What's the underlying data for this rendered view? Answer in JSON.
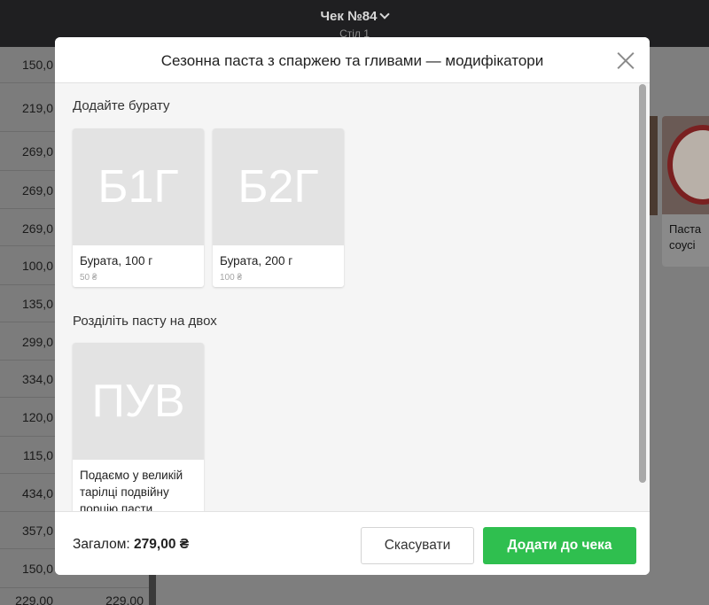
{
  "topbar": {
    "title": "Чек №84",
    "subtitle": "Стіл 1"
  },
  "background_rows": [
    {
      "price": "150,0",
      "total": ""
    },
    {
      "price": "219,0",
      "total": ""
    },
    {
      "price": "269,0",
      "total": ""
    },
    {
      "price": "269,0",
      "total": ""
    },
    {
      "price": "269,0",
      "total": ""
    },
    {
      "price": "100,0",
      "total": ""
    },
    {
      "price": "135,0",
      "total": ""
    },
    {
      "price": "299,0",
      "total": ""
    },
    {
      "price": "334,0",
      "total": ""
    },
    {
      "price": "120,0",
      "total": ""
    },
    {
      "price": "115,0",
      "total": ""
    },
    {
      "price": "434,0",
      "total": ""
    },
    {
      "price": "357,0",
      "total": ""
    },
    {
      "price": "150,0",
      "total": ""
    },
    {
      "price": "229,00",
      "total": "229,00"
    }
  ],
  "background_card": {
    "label": "Паста соусі",
    "label_line1": "Паста",
    "label_line2": "соусі"
  },
  "modal": {
    "title": "Сезонна паста з спаржею та гливами — модифікатори",
    "close_icon": "close-icon",
    "groups": [
      {
        "title": "Додайте бурату",
        "items": [
          {
            "abbr": "Б1Г",
            "name": "Бурата, 100 г",
            "price": "50 ₴"
          },
          {
            "abbr": "Б2Г",
            "name": "Бурата, 200 г",
            "price": "100 ₴"
          }
        ]
      },
      {
        "title": "Розділіть пасту на двох",
        "items": [
          {
            "abbr": "ПУВ",
            "name": "Подаємо у великій тарілці подвійну порцію пасти",
            "price": ""
          }
        ]
      }
    ],
    "footer": {
      "total_label": "Загалом:",
      "total_value": "279,00 ₴",
      "cancel_label": "Скасувати",
      "add_label": "Додати до чека"
    }
  },
  "colors": {
    "accent": "#2fbf4f",
    "overlay": "#7a7a7a",
    "topbar": "#1f1f21"
  }
}
